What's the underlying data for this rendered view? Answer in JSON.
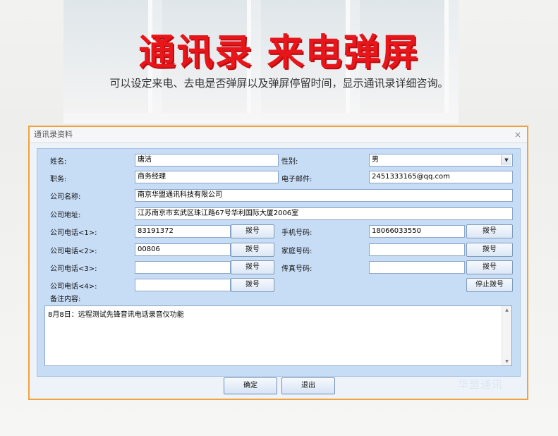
{
  "banner": {
    "headline": "通讯录  来电弹屏",
    "subline": "可以设定来电、去电是否弹屏以及弹屏停留时间，显示通讯录详细咨询。"
  },
  "dialog": {
    "title": "通讯录资料",
    "close_glyph": "×",
    "fields": {
      "name_label": "姓名:",
      "name_value": "唐洁",
      "gender_label": "性别:",
      "gender_value": "男",
      "title_label": "职务:",
      "title_value": "商务经理",
      "email_label": "电子邮件:",
      "email_value": "2451333165@qq.com",
      "company_label": "公司名称:",
      "company_value": "南京华盟通讯科技有限公司",
      "address_label": "公司地址:",
      "address_value": "江苏南京市玄武区珠江路67号华利国际大厦2006室",
      "phone1_label": "公司电话<1>:",
      "phone1_value": "83191372",
      "phone2_label": "公司电话<2>:",
      "phone2_value": "00806",
      "phone3_label": "公司电话<3>:",
      "phone3_value": "",
      "phone4_label": "公司电话<4>:",
      "phone4_value": "",
      "mobile_label": "手机号码:",
      "mobile_value": "18066033550",
      "home_label": "家庭号码:",
      "home_value": "",
      "fax_label": "传真号码:",
      "fax_value": "",
      "notes_label": "备注内容:",
      "notes_value": "8月8日：远程测试先锋音讯电话录音仪功能"
    },
    "dial_label": "拨号",
    "stop_dial_label": "停止拨号",
    "ok_label": "确定",
    "exit_label": "退出",
    "watermark": "华盟通讯"
  },
  "colors": {
    "headline": "#e8161a",
    "dialog_border": "#f0a33c",
    "client_bg": "#c7dcf5"
  }
}
